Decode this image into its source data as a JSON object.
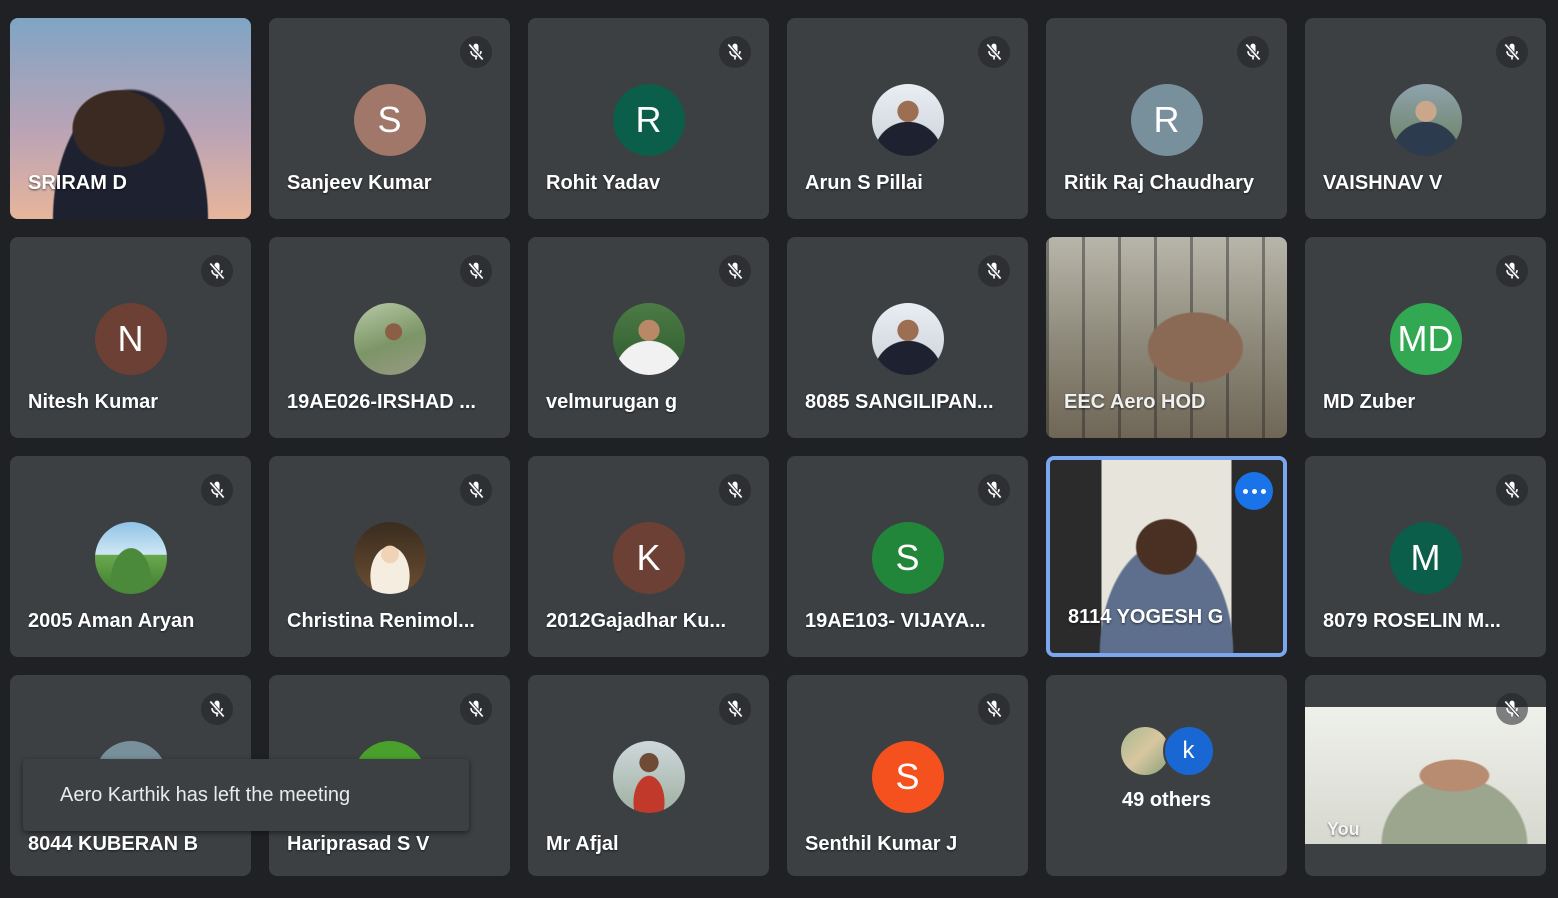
{
  "colors": {
    "background": "#202124",
    "tile": "#3c4043",
    "active_border": "#7aa7f0",
    "more_button": "#1a73e8"
  },
  "participants": [
    {
      "name": "SRIRAM D",
      "type": "video",
      "muted": false
    },
    {
      "name": "Sanjeev Kumar",
      "initial": "S",
      "avatar_color": "#a1776a",
      "muted": true
    },
    {
      "name": "Rohit Yadav",
      "initial": "R",
      "avatar_color": "#0b5e49",
      "muted": true
    },
    {
      "name": "Arun S Pillai",
      "type": "photo",
      "muted": true
    },
    {
      "name": "Ritik Raj Chaudhary",
      "initial": "R",
      "avatar_color": "#78909c",
      "muted": true
    },
    {
      "name": "VAISHNAV V",
      "type": "photo",
      "muted": true
    },
    {
      "name": "Nitesh Kumar",
      "initial": "N",
      "avatar_color": "#6d4035",
      "muted": true
    },
    {
      "name": "19AE026-IRSHAD ...",
      "type": "photo",
      "muted": true
    },
    {
      "name": "velmurugan g",
      "type": "photo",
      "muted": true
    },
    {
      "name": "8085 SANGILIPAN...",
      "type": "photo",
      "muted": true
    },
    {
      "name": "EEC Aero HOD",
      "type": "video",
      "muted": false
    },
    {
      "name": "MD Zuber",
      "initial": "MD",
      "avatar_color": "#33a852",
      "muted": true
    },
    {
      "name": "2005 Aman Aryan",
      "type": "photo",
      "muted": true
    },
    {
      "name": "Christina Renimol...",
      "type": "photo",
      "muted": true
    },
    {
      "name": "2012Gajadhar Ku...",
      "initial": "K",
      "avatar_color": "#6d4035",
      "muted": true
    },
    {
      "name": "19AE103- VIJAYA...",
      "initial": "S",
      "avatar_color": "#22863a",
      "muted": true
    },
    {
      "name": "8114 YOGESH G",
      "type": "video",
      "muted": false,
      "active": true
    },
    {
      "name": "8079 ROSELIN M...",
      "initial": "M",
      "avatar_color": "#0b5e49",
      "muted": true
    },
    {
      "name": "8044 KUBERAN B",
      "initial": "",
      "avatar_color": "#78909c",
      "muted": true
    },
    {
      "name": "Hariprasad S V",
      "initial": "",
      "avatar_color": "#4aa02c",
      "muted": true
    },
    {
      "name": "Mr Afjal",
      "type": "photo",
      "muted": true
    },
    {
      "name": "Senthil Kumar J",
      "initial": "S",
      "avatar_color": "#f4511e",
      "muted": true
    }
  ],
  "others_tile": {
    "label": "49 others",
    "mini_initial": "k"
  },
  "self_tile": {
    "label": "You"
  },
  "toast": {
    "message": "Aero Karthik has left the meeting"
  },
  "icons": {
    "muted": "mic-off-icon",
    "more": "more-options-icon"
  }
}
